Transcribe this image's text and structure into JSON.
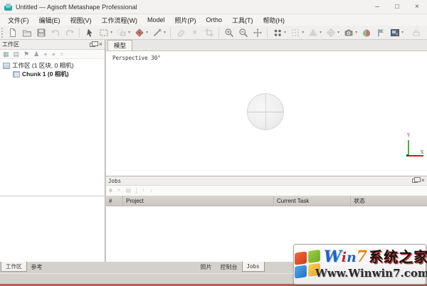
{
  "window": {
    "title": "Untitled — Agisoft Metashape Professional",
    "controls": {
      "minimize": "–",
      "maximize": "□",
      "close": "×"
    }
  },
  "menu": {
    "items": [
      "文件(F)",
      "编辑(E)",
      "视图(V)",
      "工作流程(W)",
      "Model",
      "照片(P)",
      "Ortho",
      "工具(T)",
      "帮助(H)"
    ]
  },
  "toolbar": {
    "icons": [
      "new-project",
      "open-project",
      "save-project",
      "undo",
      "redo",
      "navigation-tool",
      "rectangle-selection-tool",
      "shape-selection-tool",
      "object-gizmo-tool",
      "measure-tool",
      "eraser-tool",
      "delete-tool",
      "crop-region-tool",
      "zoom-in",
      "zoom-out",
      "reset-view",
      "point-cloud-view",
      "dense-cloud-view",
      "mesh-view",
      "tiled-model-view",
      "capture-view",
      "textured-model-view",
      "show-markers",
      "ortho-view",
      "misc-tool"
    ]
  },
  "workspace": {
    "title": "工作区",
    "tree": {
      "root": "工作区 (1 区块, 0 相机)",
      "chunk": "Chunk 1 (0 相机)"
    },
    "mini_icons": [
      "add-chunk",
      "add-photos",
      "add-marker",
      "add-scalebar",
      "enable-item",
      "disable-item",
      "remove-item"
    ]
  },
  "model": {
    "tab": "模型",
    "overlay": "Perspective 30°",
    "axis_labels": {
      "vertical": "Y",
      "horizontal": "X"
    }
  },
  "jobs": {
    "title": "Jobs",
    "columns": [
      "#",
      "Project",
      "Current Task",
      "状态"
    ],
    "rows": []
  },
  "bottom_tabs": {
    "left": [
      "工作区",
      "参考"
    ],
    "center": [
      "照片",
      "控制台",
      "Jobs"
    ],
    "left_active": "工作区",
    "center_active": "Jobs"
  },
  "watermark": {
    "win7_letters": [
      "W",
      "i",
      "n",
      "7"
    ],
    "site_name": "系统之家",
    "url": "Www.Winwin7.com"
  },
  "colors": {
    "axis_x": "#c0241b",
    "axis_y": "#4fae42",
    "bottom_strip": "#b06258",
    "panel_bg": "#f0eeec",
    "header_gray": "#d9d6d2"
  }
}
